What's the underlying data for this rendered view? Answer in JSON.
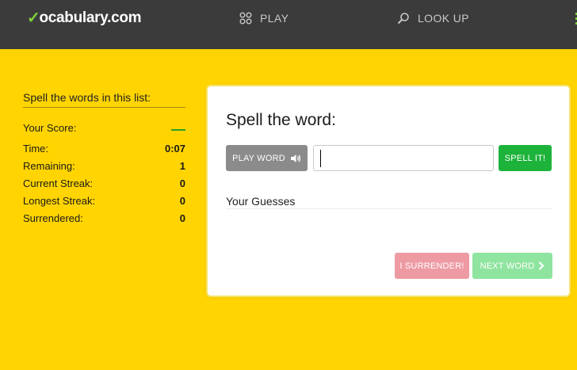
{
  "header": {
    "logo_check": "✓",
    "logo_text": "ocabulary.com",
    "nav": {
      "play": {
        "label": "PLAY",
        "icon": "grid-icon"
      },
      "lookup": {
        "label": "LOOK UP",
        "icon": "search-icon"
      }
    },
    "menu_icon": "hamburger-icon"
  },
  "stats": {
    "heading": "Spell the words in this list:",
    "score_label": "Your Score:",
    "score_value": "—",
    "rows": [
      {
        "label": "Time:",
        "value": "0:07"
      },
      {
        "label": "Remaining:",
        "value": "1"
      },
      {
        "label": "Current Streak:",
        "value": "0"
      },
      {
        "label": "Longest Streak:",
        "value": "0"
      },
      {
        "label": "Surrendered:",
        "value": "0"
      }
    ]
  },
  "card": {
    "title": "Spell the word:",
    "play_word_label": "PLAY WORD",
    "play_word_icon": "speaker-icon",
    "input_value": "",
    "spell_it_label": "SPELL IT!",
    "guesses_label": "Your Guesses",
    "surrender_label": "I SURRENDER!",
    "next_word_label": "NEXT WORD",
    "next_word_icon": "chevron-right-icon"
  },
  "colors": {
    "background": "#FFD400",
    "header": "#3b3b3b",
    "brand_green": "#7fd13b",
    "spell_button": "#1db33b",
    "surrender_button": "#ee9aa3",
    "next_button": "#8fe49f",
    "play_button": "#8b8b8b"
  }
}
